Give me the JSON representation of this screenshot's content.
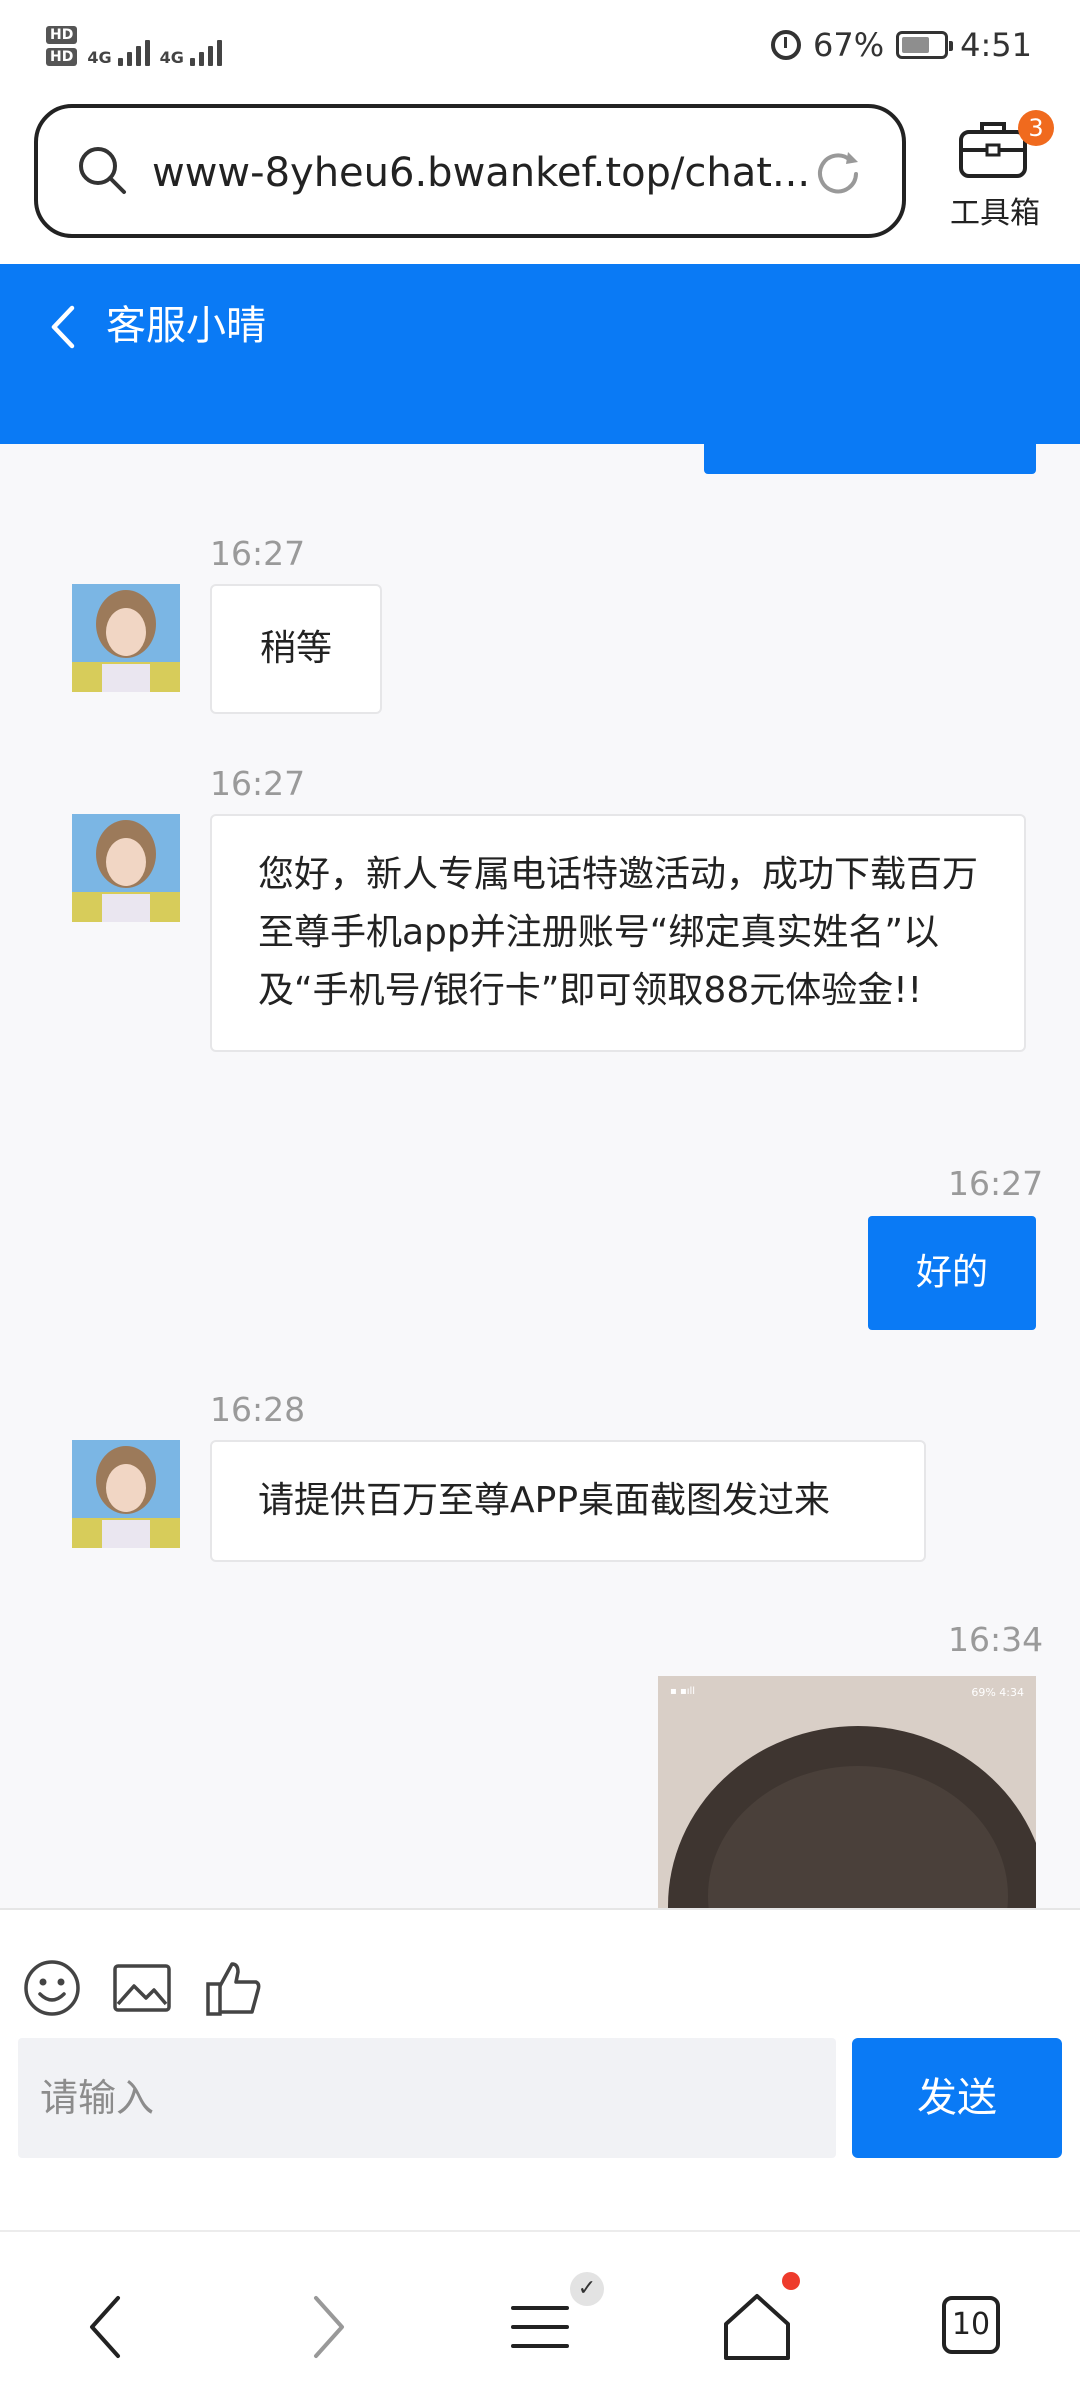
{
  "status_bar": {
    "signal1_label": "4G",
    "signal2_label": "4G",
    "hd_label": "HD",
    "battery_percent": "67%",
    "battery_level": 0.67,
    "time": "4:51"
  },
  "browser": {
    "url": "www-8yheu6.bwankef.top/chat...",
    "toolbox_label": "工具箱",
    "toolbox_badge": "3",
    "tabs_count": "10"
  },
  "chat": {
    "title": "客服小晴",
    "messages": [
      {
        "time": "16:27",
        "text": "稍等",
        "from": "agent"
      },
      {
        "time": "16:27",
        "text": "您好，新人专属电话特邀活动，成功下载百万至尊手机app并注册账号“绑定真实姓名”以及“手机号/银行卡”即可领取88元体验金!!",
        "from": "agent"
      },
      {
        "time": "16:27",
        "text": "好的",
        "from": "user"
      },
      {
        "time": "16:28",
        "text": "请提供百万至尊APP桌面截图发过来",
        "from": "agent"
      },
      {
        "time": "16:34",
        "from": "user",
        "image": "screenshot"
      }
    ],
    "shot_status": {
      "battery": "69%",
      "time": "4:34"
    }
  },
  "composer": {
    "placeholder": "请输入",
    "send_label": "发送"
  },
  "colors": {
    "accent": "#0a7af5",
    "badge": "#f06a1e",
    "dot": "#ee3b2c"
  }
}
